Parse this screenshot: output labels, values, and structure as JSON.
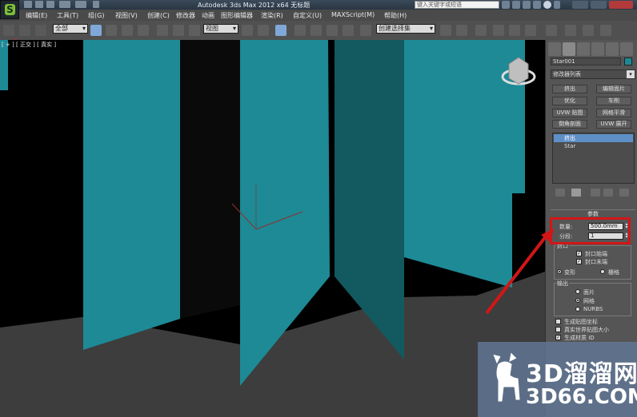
{
  "window": {
    "title": "Autodesk 3ds Max  2012 x64    无标题",
    "search_placeholder": "键入关键字或短语"
  },
  "menubar": {
    "items": [
      "编辑(E)",
      "工具(T)",
      "组(G)",
      "视图(V)",
      "创建(C)",
      "修改器",
      "动画",
      "图形编辑器",
      "渲染(R)",
      "自定义(U)",
      "MAXScript(M)",
      "帮助(H)"
    ]
  },
  "toolbar": {
    "selection_filter": "全部",
    "reference_coord": "视图",
    "named_selection_set": "创建选择集"
  },
  "viewport": {
    "label": "[ + ] [ 正交 ] [ 真实 ]"
  },
  "command_panel": {
    "object_name": "Star001",
    "object_color": "#1a8b95",
    "modifier_list": "修改器列表",
    "modifier_buttons": [
      [
        "挤出",
        "编辑面片"
      ],
      [
        "优化",
        "车削"
      ],
      [
        "UVW 贴图",
        "网格平滑"
      ],
      [
        "倒角剖面",
        "UVW 展开"
      ]
    ],
    "stack": {
      "modifier": "挤出",
      "base": "Star"
    },
    "parameters": {
      "rollout_title": "参数",
      "amount_label": "数量:",
      "amount_value": "500.0mm",
      "segments_label": "分段:",
      "segments_value": "1",
      "capping_group": "封口",
      "cap_start": "封口始端",
      "cap_end": "封口末端",
      "morph": "变形",
      "grid": "栅格",
      "output_group": "输出",
      "output_patch": "面片",
      "output_mesh": "网格",
      "output_nurbs": "NURBS",
      "gen_mapping": "生成贴图坐标",
      "real_world": "真实世界贴图大小",
      "gen_mat_ids": "生成材质 ID"
    }
  },
  "watermark": {
    "text_cn": "3D溜溜网",
    "text_en": "3D66.COM"
  },
  "colors": {
    "teal_face": "#1d8a96",
    "teal_dark": "#125a60",
    "annotation_red": "#d21616"
  }
}
